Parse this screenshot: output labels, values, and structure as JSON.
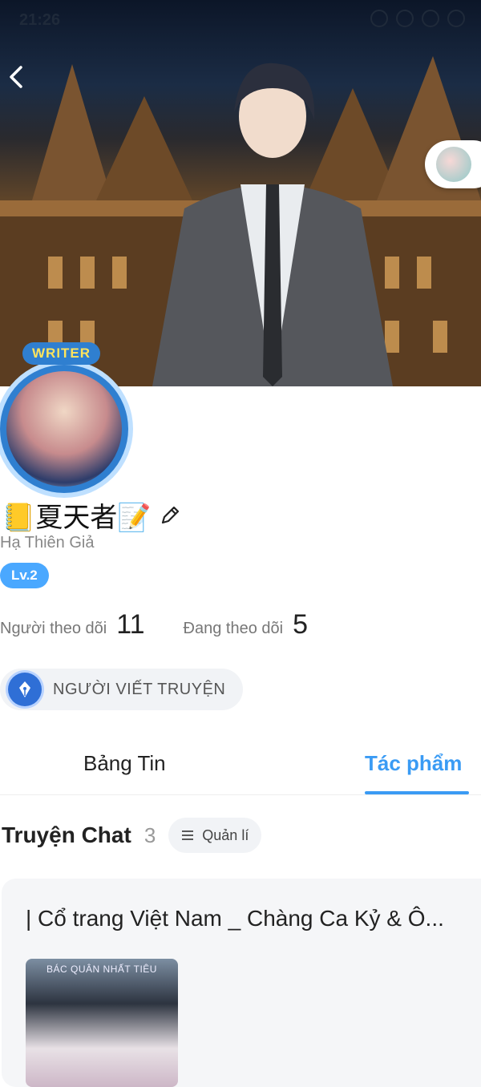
{
  "statusbar": {
    "time": "21:26"
  },
  "profile": {
    "writer_badge": "WRITER",
    "display_name": "📒夏天者📝",
    "subname": "Hạ Thiên Giả",
    "level": "Lv.2",
    "followers_label": "Người theo dõi",
    "followers_count": "11",
    "following_label": "Đang theo dõi",
    "following_count": "5",
    "role": "NGƯỜI VIẾT TRUYỆN"
  },
  "tabs": [
    {
      "label": "Bảng Tin",
      "active": false
    },
    {
      "label": "Tác phẩm",
      "active": true
    }
  ],
  "section": {
    "title": "Truyện Chat",
    "count": "3",
    "manage_label": "Quản lí"
  },
  "story": {
    "title": "| Cổ trang Việt Nam _ Chàng Ca Kỷ & Ô...",
    "cover_text": "BÁC QUÂN NHẤT TIÊU"
  },
  "colors": {
    "accent": "#3a9bf4",
    "level_badge": "#4aa8ff",
    "role_icon": "#2f6fd6"
  },
  "icons": [
    "back-arrow-icon",
    "edit-pencil-icon",
    "fountain-pen-icon",
    "menu-lines-icon"
  ]
}
